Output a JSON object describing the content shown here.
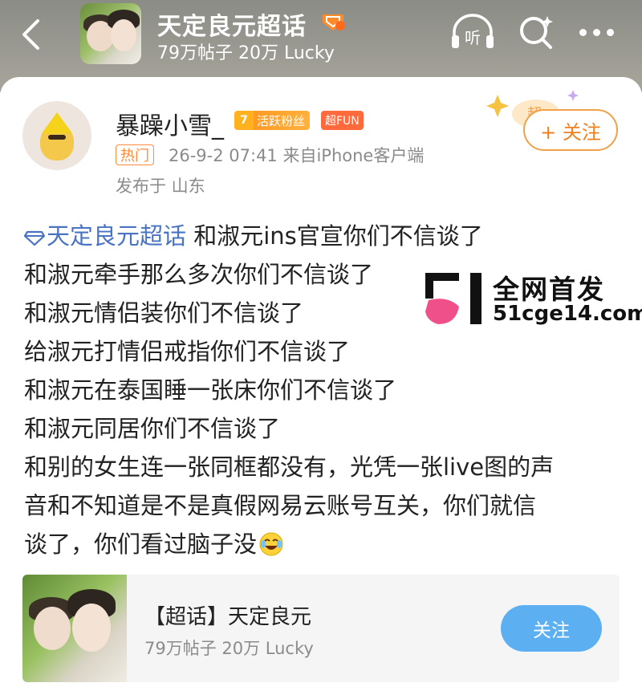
{
  "header": {
    "topic_title": "天定良元超话",
    "topic_stats": "79万帖子 20万 Lucky",
    "listen_label": "听",
    "icons": [
      "back-arrow-icon",
      "topic-badge-icon",
      "listen-icon",
      "search-icon",
      "more-icon"
    ]
  },
  "post": {
    "user_name": "暴躁小雪_",
    "fan_level": "7",
    "fan_badge": "活跃粉丝",
    "fun_badge": "超FUN",
    "hot_tag": "热门",
    "meta": "26-9-2 07:41  来自iPhone客户端",
    "location": "发布于 山东",
    "follow_label": "+ 关注",
    "follow_deco_text": "超",
    "topic_link": "天定良元超话",
    "lines": [
      " 和淑元ins官宣你们不信谈了",
      "和淑元牵手那么多次你们不信谈了",
      "和淑元情侣装你们不信谈了",
      "给淑元打情侣戒指你们不信谈了",
      "和淑元在泰国睡一张床你们不信谈了",
      "和淑元同居你们不信谈了",
      "和别的女生连一张同框都没有，光凭一张live图的声",
      "音和不知道是不是真假网易云账号互关，你们就信",
      "谈了，你们看过脑子没"
    ]
  },
  "watermark": {
    "line1": "全网首发",
    "line2": "51cge14.com"
  },
  "topic_card": {
    "title": "【超话】天定良元",
    "stats": "79万帖子 20万 Lucky",
    "follow_label": "关注"
  },
  "colors": {
    "accent_orange": "#f07f1e",
    "link_blue": "#4a74c3",
    "follow_blue": "#5cb0f2",
    "meta_gray": "#8b8b8b"
  }
}
